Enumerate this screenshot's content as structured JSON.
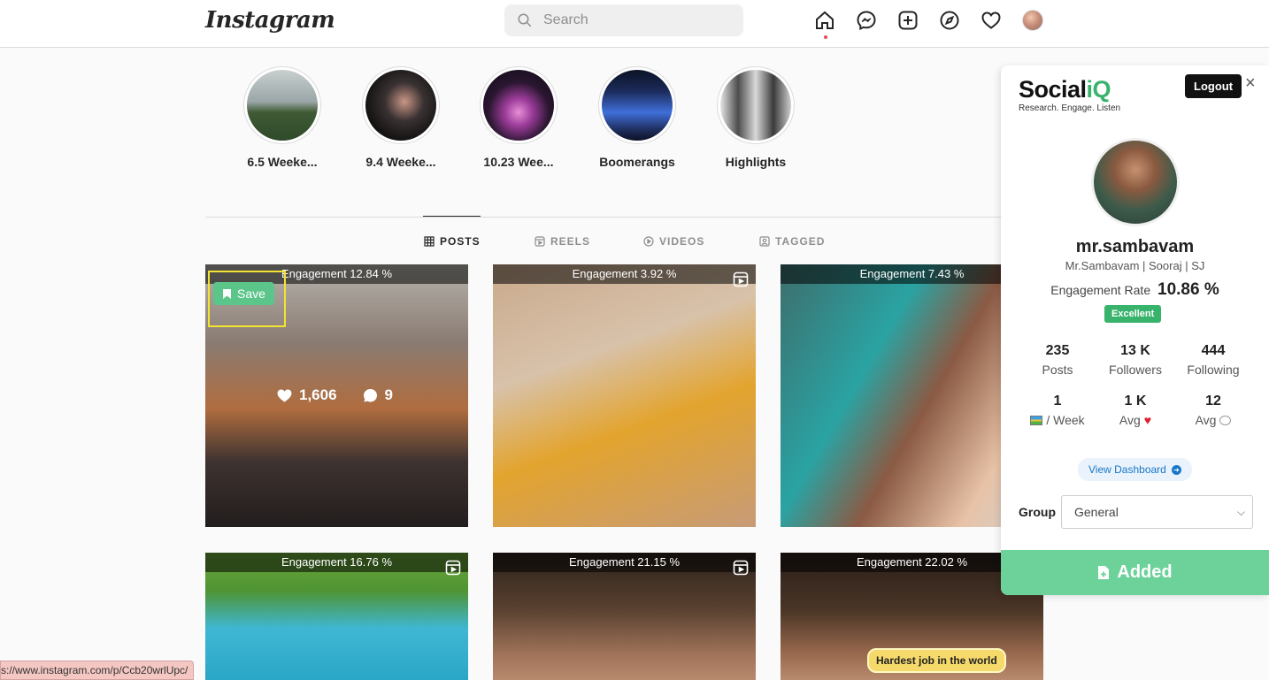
{
  "nav": {
    "logo": "Instagram",
    "search_placeholder": "Search"
  },
  "highlights": [
    {
      "label": "6.5 Weeke..."
    },
    {
      "label": "9.4 Weeke..."
    },
    {
      "label": "10.23 Wee..."
    },
    {
      "label": "Boomerangs"
    },
    {
      "label": "Highlights"
    }
  ],
  "tabs": [
    {
      "label": "POSTS",
      "active": true
    },
    {
      "label": "REELS"
    },
    {
      "label": "VIDEOS"
    },
    {
      "label": "TAGGED"
    }
  ],
  "posts": [
    {
      "engagement": "Engagement 12.84 %",
      "likes": "1,606",
      "comments": "9",
      "save_label": "Save"
    },
    {
      "engagement": "Engagement 3.92 %"
    },
    {
      "engagement": "Engagement 7.43 %"
    },
    {
      "engagement": "Engagement 16.76 %"
    },
    {
      "engagement": "Engagement 21.15 %"
    },
    {
      "engagement": "Engagement 22.02 %",
      "caption": "Hardest job in the world"
    }
  ],
  "status_url": "s://www.instagram.com/p/Ccb20wrlUpc/",
  "panel": {
    "brand_main": "Social",
    "brand_iq": "iQ",
    "tagline": "Research. Engage. Listen",
    "logout": "Logout",
    "close": "×",
    "username": "mr.sambavam",
    "full_name": "Mr.Sambavam | Sooraj | SJ",
    "engagement_label": "Engagement Rate",
    "engagement_value": "10.86 %",
    "rating": "Excellent",
    "stats": [
      {
        "value": "235",
        "label": "Posts"
      },
      {
        "value": "13 K",
        "label": "Followers"
      },
      {
        "value": "444",
        "label": "Following"
      },
      {
        "value": "1",
        "label": "/ Week"
      },
      {
        "value": "1 K",
        "label": "Avg"
      },
      {
        "value": "12",
        "label": "Avg"
      }
    ],
    "dashboard_label": "View Dashboard",
    "group_label": "Group",
    "group_value": "General",
    "added_label": "Added"
  },
  "colors": {
    "socialiq_green": "#37b36b",
    "added_green": "#6dd29a",
    "save_green": "#5bc58a",
    "highlight_yellow": "#f3e332"
  }
}
